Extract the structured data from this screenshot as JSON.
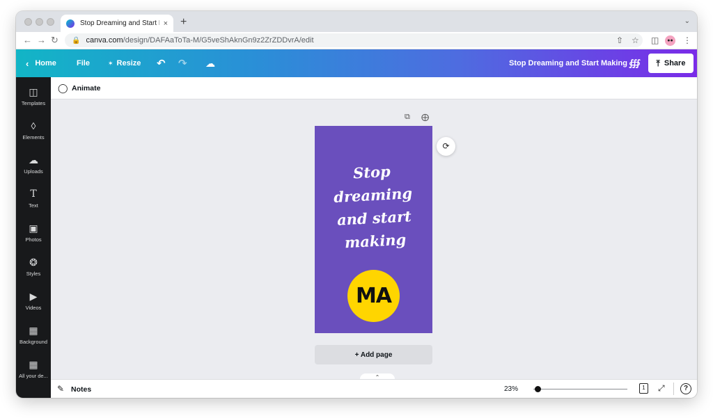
{
  "browser": {
    "tab_title": "Stop Dreaming and Start Maki",
    "tab_close": "×",
    "new_tab": "+",
    "url_host": "canva.com",
    "url_path": "/design/DAFAaToTa-M/G5veShAknGn9z2ZrZDDvrA/edit"
  },
  "header": {
    "home_label": "Home",
    "file_label": "File",
    "resize_label": "Resize",
    "design_title": "Stop Dreaming and Start Making",
    "share_label": "Share"
  },
  "sidebar": {
    "items": [
      {
        "label": "Templates",
        "icon": "templates-icon"
      },
      {
        "label": "Elements",
        "icon": "elements-icon"
      },
      {
        "label": "Uploads",
        "icon": "uploads-icon"
      },
      {
        "label": "Text",
        "icon": "text-icon"
      },
      {
        "label": "Photos",
        "icon": "photos-icon"
      },
      {
        "label": "Styles",
        "icon": "styles-icon"
      },
      {
        "label": "Videos",
        "icon": "videos-icon"
      },
      {
        "label": "Background",
        "icon": "background-icon"
      },
      {
        "label": "All your de...",
        "icon": "all-designs-icon"
      }
    ]
  },
  "toolbar": {
    "animate_label": "Animate"
  },
  "design": {
    "quote_lines": [
      "Stop",
      "dreaming",
      "and start",
      "making"
    ],
    "logo_text": "MA",
    "background_color": "#6a4fbd",
    "logo_color": "#ffd500"
  },
  "canvas": {
    "add_page_label": "+ Add page"
  },
  "footer": {
    "notes_label": "Notes",
    "zoom_label": "23%",
    "zoom_level": 0.23,
    "page_count": "1",
    "help_label": "?"
  }
}
